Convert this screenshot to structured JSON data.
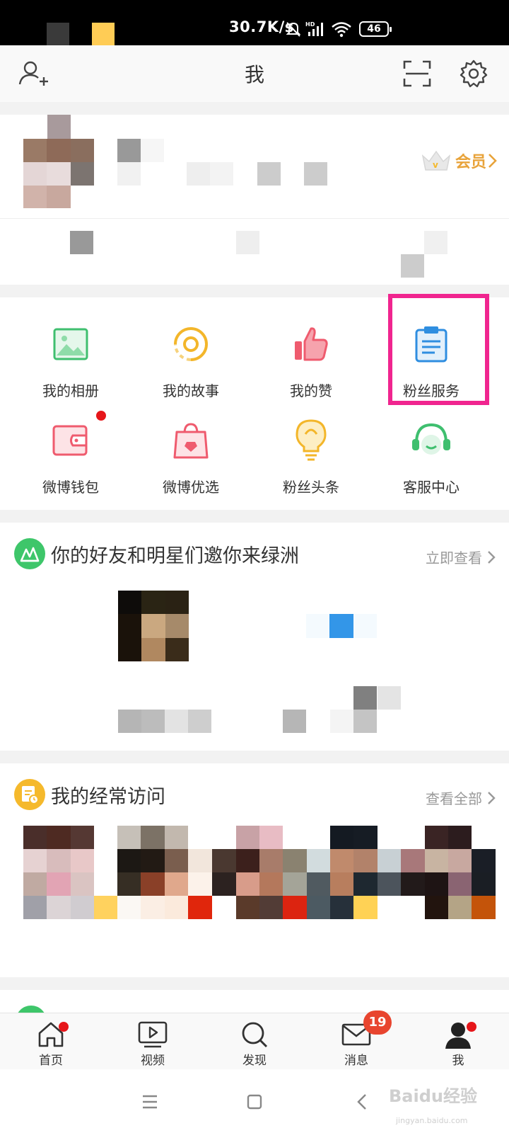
{
  "status_bar": {
    "speed": "30.7K/s",
    "battery": "46",
    "icons": [
      "mute-icon",
      "hd-signal-icon",
      "wifi-icon",
      "battery-icon"
    ]
  },
  "header": {
    "title": "我",
    "icons": [
      "add-friend-icon",
      "scan-icon",
      "settings-icon"
    ]
  },
  "profile": {
    "vip_label": "会员",
    "icons": [
      "crown-icon",
      "chevron-right-icon"
    ]
  },
  "grid": [
    {
      "label": "我的相册",
      "icon": "photo-album-icon",
      "color": "#3fbf6f"
    },
    {
      "label": "我的故事",
      "icon": "story-icon",
      "color": "#f3b62a"
    },
    {
      "label": "我的赞",
      "icon": "thumbs-up-icon",
      "color": "#ef5b6e"
    },
    {
      "label": "粉丝服务",
      "icon": "clipboard-icon",
      "color": "#2f8ee0"
    },
    {
      "label": "微博钱包",
      "icon": "wallet-icon",
      "color": "#ef5b6e"
    },
    {
      "label": "微博优选",
      "icon": "shopping-bag-icon",
      "color": "#ef5b6e"
    },
    {
      "label": "粉丝头条",
      "icon": "lightbulb-icon",
      "color": "#f3b62a"
    },
    {
      "label": "客服中心",
      "icon": "headset-icon",
      "color": "#3fbf6f"
    }
  ],
  "oasis": {
    "title": "你的好友和明星们邀你来绿洲",
    "link": "立即查看",
    "accent": "#3ec66a"
  },
  "frequent": {
    "title": "我的经常访问",
    "link": "查看全部",
    "accent": "#f5b92c"
  },
  "tabbar": [
    {
      "label": "首页",
      "icon": "home-icon"
    },
    {
      "label": "视频",
      "icon": "video-icon"
    },
    {
      "label": "发现",
      "icon": "search-icon"
    },
    {
      "label": "消息",
      "icon": "mail-icon",
      "badge": "19"
    },
    {
      "label": "我",
      "icon": "person-icon"
    }
  ],
  "watermark": {
    "text": "Baidu经验",
    "sub": "jingyan.baidu.com"
  },
  "colors": {
    "highlight": "#f0258f",
    "badge": "#e8452f",
    "vip": "#e8a33a"
  }
}
